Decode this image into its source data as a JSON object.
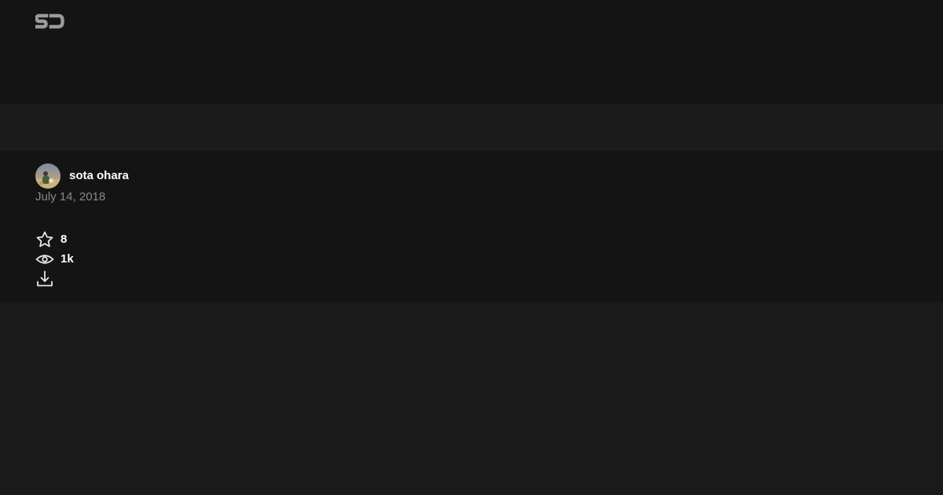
{
  "logo": {
    "icon": "sj-logo-icon",
    "color": "#9a9a9a"
  },
  "author": {
    "name": "sota ohara",
    "avatar": "avatar"
  },
  "post": {
    "date": "July 14, 2018"
  },
  "stats": {
    "stars": {
      "icon": "star-icon",
      "count": "8"
    },
    "views": {
      "icon": "eye-icon",
      "count": "1k"
    },
    "download": {
      "icon": "download-icon"
    }
  },
  "colors": {
    "background": "#1a1a1a",
    "header": "#141414",
    "band": "#1b1b1b",
    "text": "#ffffff",
    "muted": "#8a8a8a"
  }
}
